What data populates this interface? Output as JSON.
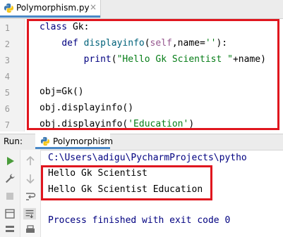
{
  "editor": {
    "tab_label": "Polymorphism.py",
    "tab_close": "×",
    "line_numbers": [
      "1",
      "2",
      "3",
      "4",
      "5",
      "6",
      "7"
    ],
    "line1": {
      "kw": "class",
      "rest": " Gk:"
    },
    "line2": {
      "indent": "    ",
      "kw": "def",
      "fn": "displayinfo",
      "open": "(",
      "self": "self",
      "mid": ",name=",
      "str": "''",
      "close": "):"
    },
    "line3": {
      "indent": "        ",
      "fn": "print",
      "open": "(",
      "str": "\"Hello Gk Scientist \"",
      "close": "+name)"
    },
    "line5": "obj=Gk()",
    "line6": "obj.displayinfo()",
    "line7": {
      "pre": "obj.displayinfo(",
      "str": "'Education'",
      "post": ")"
    }
  },
  "run": {
    "label": "Run:",
    "tab_label": "Polymorphism",
    "tab_close": "×"
  },
  "console": {
    "path": "C:\\Users\\adigu\\PycharmProjects\\pytho",
    "output": [
      "Hello Gk Scientist",
      "Hello Gk Scientist Education"
    ],
    "exit": "Process finished with exit code 0"
  },
  "colors": {
    "highlight_box": "#e0161e",
    "keyword": "#000080",
    "string": "#067d17",
    "function": "#00627a",
    "self": "#94558d",
    "run_green": "#4a9c3b"
  },
  "icons": {
    "tab": "python-file-icon",
    "run_tab": "python-run-icon",
    "toolbar": [
      "rerun-icon",
      "wrench-icon",
      "scroll-icon",
      "stop-icon",
      "layout-icon",
      "pin-icon"
    ],
    "toolbar_nav": [
      "up-arrow-icon",
      "down-arrow-icon",
      "soft-wrap-icon",
      "scroll-to-end-icon",
      "print-icon",
      "trash-icon"
    ]
  }
}
